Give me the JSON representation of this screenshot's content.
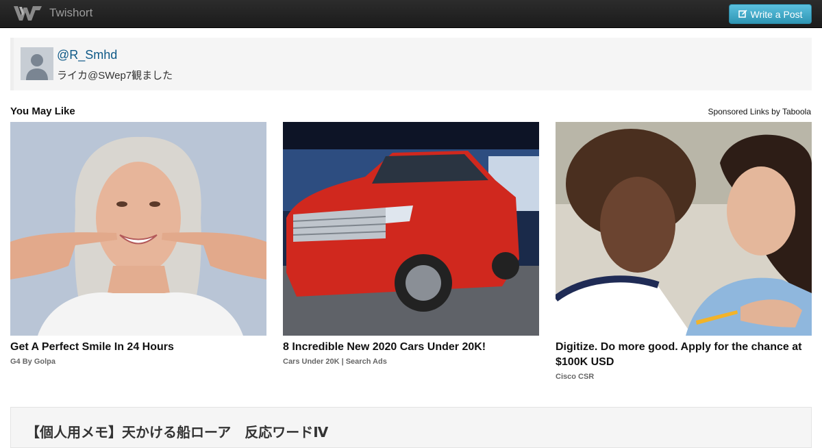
{
  "navbar": {
    "brand": "Twishort",
    "write_button": "Write a Post",
    "logo_icon": "twishort-logo-icon",
    "button_color": "#49afcd"
  },
  "post": {
    "username": "@R_Smhd",
    "text": "ライカ@SWep7観ました"
  },
  "recommendations": {
    "title": "You May Like",
    "sponsored": "Sponsored Links by Taboola",
    "items": [
      {
        "headline": "Get A Perfect Smile In 24 Hours",
        "source": "G4 By Golpa"
      },
      {
        "headline": "8 Incredible New 2020 Cars Under 20K!",
        "source": "Cars Under 20K | Search Ads"
      },
      {
        "headline": "Digitize. Do more good. Apply for the chance at $100K USD",
        "source": "Cisco CSR"
      }
    ]
  },
  "bottom": {
    "title": "【個人用メモ】天かける船ローア　反応ワードⅣ"
  }
}
